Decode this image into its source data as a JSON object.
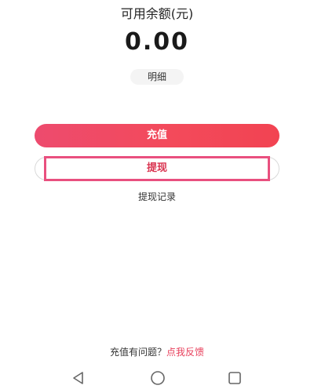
{
  "balance": {
    "title": "可用余额(元)",
    "amount": "0.00",
    "detail_label": "明细"
  },
  "actions": {
    "recharge_label": "充值",
    "withdraw_label": "提现",
    "withdraw_record_label": "提现记录"
  },
  "feedback": {
    "question": "充值有问题？",
    "link": "点我反馈"
  },
  "system_nav": {
    "back_icon": "back-triangle-icon",
    "home_icon": "home-circle-icon",
    "recent_icon": "recent-apps-square-icon"
  },
  "colors": {
    "accent": "#f0465a",
    "withdraw_text": "#d9334f",
    "link": "#e8405c"
  }
}
